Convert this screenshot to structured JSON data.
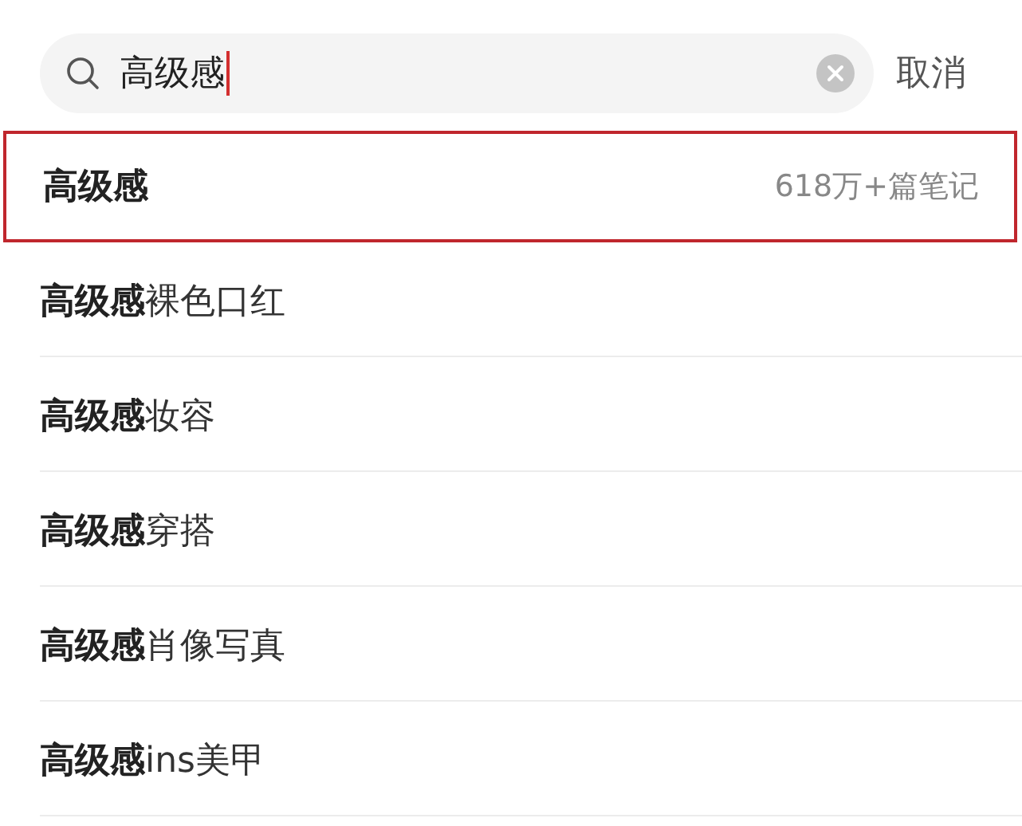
{
  "search": {
    "value": "高级感",
    "cancel": "取消"
  },
  "suggestions": [
    {
      "text": "**高级感**",
      "count": "618万+篇笔记",
      "selected": true
    },
    {
      "text": "**高级感**裸色口红",
      "selected": false
    },
    {
      "text": "**高级感**妆容",
      "selected": false
    },
    {
      "text": "**高级感**穿搭",
      "selected": false
    },
    {
      "text": "**高级感**肖像写真",
      "selected": false
    },
    {
      "text": "**高级感**ins美甲",
      "selected": false
    }
  ]
}
